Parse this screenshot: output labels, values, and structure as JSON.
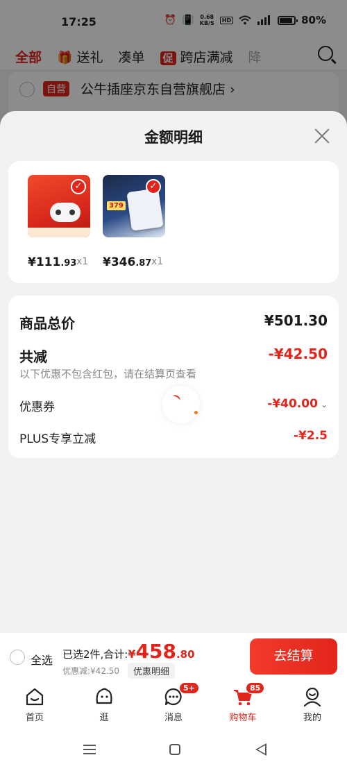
{
  "status": {
    "time": "17:25",
    "speed_top": "0.68",
    "speed_bottom": "KB/S",
    "hd": "HD",
    "battery": "80%"
  },
  "bg": {
    "tabs": {
      "all": "全部",
      "gift": "送礼",
      "bundle": "凑单",
      "promo_badge": "促",
      "promo": "跨店满减",
      "more": "降"
    },
    "store": {
      "badge": "自营",
      "name": "公牛插座京东自营旗舰店",
      "chevron": "›"
    }
  },
  "sheet": {
    "title": "金额明细",
    "products": [
      {
        "price_int": "¥111",
        "price_dec": ".93",
        "qty": "x1"
      },
      {
        "price_int": "¥346",
        "price_dec": ".87",
        "qty": "x1"
      }
    ],
    "summary": {
      "total_label": "商品总价",
      "total_value": "¥501.30",
      "reduce_label": "共减",
      "reduce_value": "-¥42.50",
      "note": "以下优惠不包含红包，请在结算页查看",
      "coupon_label": "优惠券",
      "coupon_value": "-¥40.00",
      "plus_label": "PLUS专享立减",
      "plus_value": "-¥2.5"
    }
  },
  "checkout": {
    "select_all": "全选",
    "selected_text": "已选2件,合计:",
    "currency": "¥",
    "total_int": "458",
    "total_dec": ".80",
    "discount_text": "优惠减:¥42.50",
    "detail_button": "优惠明细",
    "checkout_button": "去结算"
  },
  "nav": [
    {
      "label": "首页",
      "icon": "home-icon"
    },
    {
      "label": "逛",
      "icon": "browse-face-icon"
    },
    {
      "label": "消息",
      "icon": "message-icon",
      "badge": "5+"
    },
    {
      "label": "购物车",
      "icon": "cart-icon",
      "badge": "85",
      "active": true
    },
    {
      "label": "我的",
      "icon": "profile-icon"
    }
  ],
  "colors": {
    "accent": "#e1251b"
  }
}
